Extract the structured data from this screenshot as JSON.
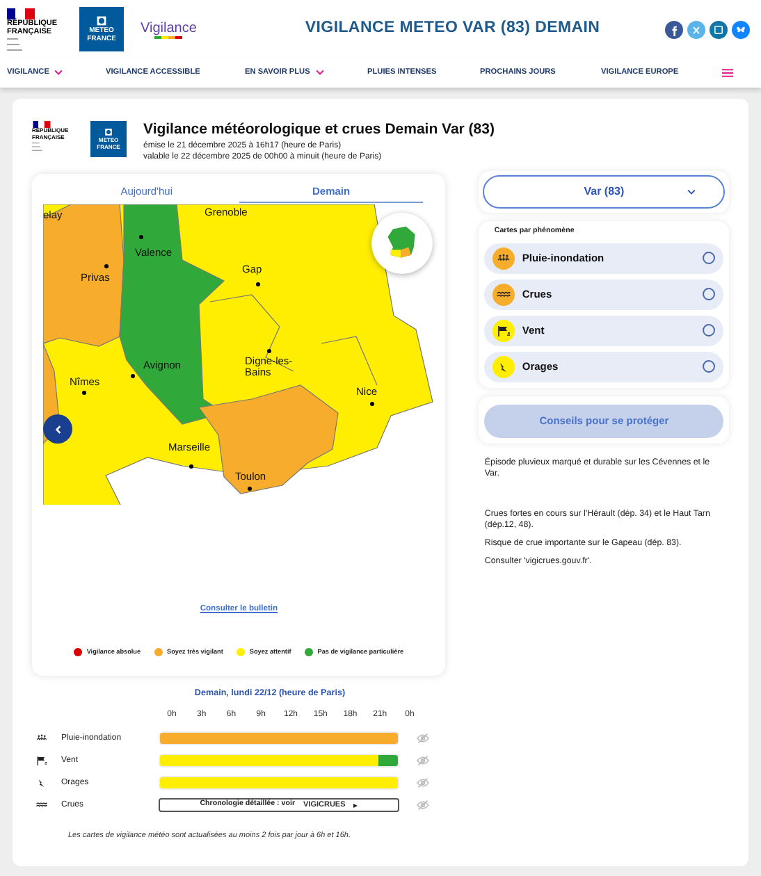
{
  "header": {
    "rf_logo": [
      "RÉPUBLIQUE",
      "FRANÇAISE"
    ],
    "mf_logo": [
      "METEO",
      "FRANCE"
    ],
    "vigilance_logo": "Vigilance",
    "title": "VIGILANCE METEO VAR (83) DEMAIN"
  },
  "nav": [
    {
      "label": "VIGILANCE",
      "dropdown": true
    },
    {
      "label": "VIGILANCE ACCESSIBLE",
      "dropdown": false
    },
    {
      "label": "EN SAVOIR PLUS",
      "dropdown": true
    },
    {
      "label": "PLUIES INTENSES",
      "dropdown": false
    },
    {
      "label": "PROCHAINS JOURS",
      "dropdown": false
    },
    {
      "label": "VIGILANCE EUROPE",
      "dropdown": false
    }
  ],
  "bulletin": {
    "rf_logo": [
      "RÉPUBLIQUE",
      "FRANÇAISE"
    ],
    "mf_logo": [
      "METEO",
      "FRANCE"
    ],
    "title": "Vigilance météorologique et crues Demain Var (83)",
    "issued": "émise le 21 décembre 2025 à 16h17 (heure de Paris)",
    "valid": "valable le 22 décembre 2025 de 00h00 à minuit (heure de Paris)"
  },
  "tabs": [
    {
      "label": "Aujourd'hui",
      "selected": false
    },
    {
      "label": "Demain",
      "selected": true
    }
  ],
  "map": {
    "cities": [
      {
        "name": "elay",
        "dot": false
      },
      {
        "name": "Grenoble",
        "dot": false
      },
      {
        "name": "Valence",
        "dot": true
      },
      {
        "name": "Privas",
        "dot": true
      },
      {
        "name": "Gap",
        "dot": true
      },
      {
        "name": "Avignon",
        "dot": true
      },
      {
        "name": "Nîmes",
        "dot": true
      },
      {
        "name": "Digne-les-Bains",
        "dot": true
      },
      {
        "name": "Nice",
        "dot": true
      },
      {
        "name": "Marseille",
        "dot": true
      },
      {
        "name": "Toulon",
        "dot": true
      }
    ],
    "link": "Consulter le bulletin"
  },
  "legend": [
    {
      "label": "Vigilance absolue",
      "color": "#d90000"
    },
    {
      "label": "Soyez très vigilant",
      "color": "#f7ad2b"
    },
    {
      "label": "Soyez attentif",
      "color": "#ffee00"
    },
    {
      "label": "Pas de vigilance particulière",
      "color": "#31a83a"
    }
  ],
  "department": {
    "label": "Var (83)"
  },
  "phenomena": {
    "title": "Cartes par phénomène",
    "items": [
      {
        "label": "Pluie-inondation",
        "kind": "rain",
        "color": "#f7ad2b",
        "selected": false
      },
      {
        "label": "Crues",
        "kind": "flood",
        "color": "#f7ad2b",
        "selected": false
      },
      {
        "label": "Vent",
        "kind": "wind",
        "color": "#ffee00",
        "selected": false
      },
      {
        "label": "Orages",
        "kind": "storm",
        "color": "#ffee00",
        "selected": false
      }
    ]
  },
  "advice_button": "Conseils pour se protéger",
  "comment": [
    "Épisode pluvieux marqué et durable sur les Cévennes et le Var.",
    "Crues fortes en cours sur l'Hérault (dép. 34) et le Haut Tarn (dép.12, 48).",
    "Risque de crue importante sur le Gapeau (dép. 83).",
    "Consulter 'vigicrues.gouv.fr'."
  ],
  "timeline": {
    "title": "Demain, lundi 22/12 (heure de Paris)",
    "hours": [
      "0h",
      "3h",
      "6h",
      "9h",
      "12h",
      "15h",
      "18h",
      "21h",
      "0h"
    ],
    "rows": [
      {
        "label": "Pluie-inondation",
        "kind": "rain",
        "segments": [
          {
            "color": "#f7ad2b",
            "level": 1
          }
        ]
      },
      {
        "label": "Vent",
        "kind": "wind",
        "segments": [
          {
            "color": "#ffee00",
            "level": 0.92
          },
          {
            "color": "#31a83a",
            "level": 0.08
          }
        ]
      },
      {
        "label": "Orages",
        "kind": "storm",
        "segments": [
          {
            "color": "#ffee00",
            "level": 1
          }
        ]
      },
      {
        "label": "Crues",
        "kind": "flood",
        "link": "Chronologie détaillée : voir",
        "link_logo": "VIGICRUES"
      }
    ]
  },
  "note": "Les cartes de vigilance météo sont actualisées au moins 2 fois par jour à 6h et 16h."
}
